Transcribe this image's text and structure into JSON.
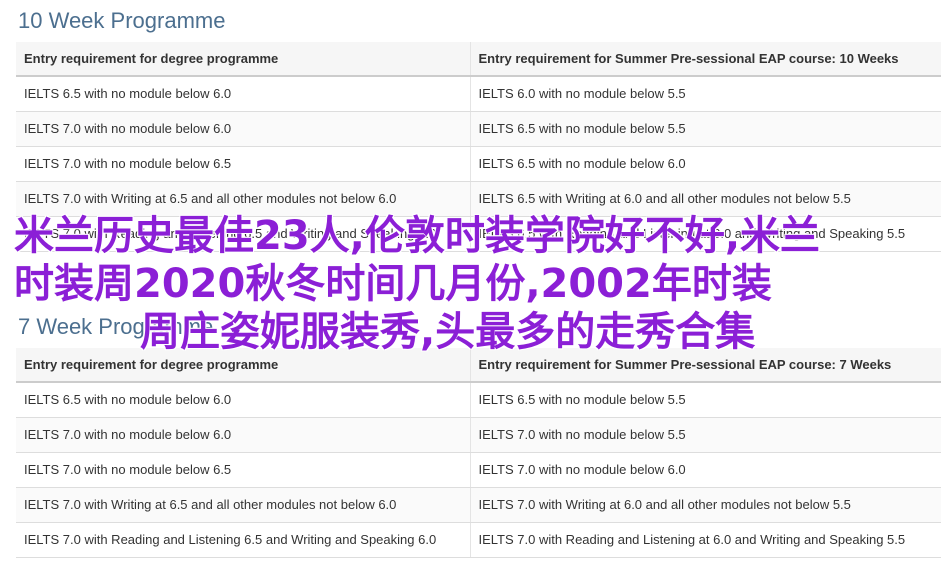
{
  "sections": [
    {
      "title": "10 Week Programme",
      "headers": [
        "Entry requirement for degree programme",
        "Entry requirement for Summer Pre-sessional EAP course: 10 Weeks"
      ],
      "rows": [
        [
          "IELTS 6.5 with no module below 6.0",
          "IELTS 6.0 with no module below 5.5"
        ],
        [
          "IELTS 7.0 with no module below 6.0",
          "IELTS 6.5 with no module below 5.5"
        ],
        [
          "IELTS 7.0 with no module below 6.5",
          "IELTS 6.5 with no module below 6.0"
        ],
        [
          "IELTS 7.0 with Writing at 6.5 and all other modules not below 6.0",
          "IELTS 6.5 with Writing at 6.0 and all other modules not below 5.5"
        ],
        [
          "IELTS 7.0 with Reading and Listening 6.5 and Writing and Speaking 6.0",
          "IELTS 6.5 with Reading and Listening at 6.0 and Writing and Speaking 5.5"
        ]
      ]
    },
    {
      "title": "7 Week Programme",
      "headers": [
        "Entry requirement for degree programme",
        "Entry requirement for Summer Pre-sessional EAP course: 7 Weeks"
      ],
      "rows": [
        [
          "IELTS 6.5 with no module below 6.0",
          "IELTS 6.5 with no module below 5.5"
        ],
        [
          "IELTS 7.0 with no module below 6.0",
          "IELTS 7.0 with no module below 5.5"
        ],
        [
          "IELTS 7.0 with no module below 6.5",
          "IELTS 7.0 with no module below 6.0"
        ],
        [
          "IELTS 7.0 with Writing at 6.5 and all other modules not below 6.0",
          "IELTS 7.0 with Writing at 6.0 and all other modules not below 5.5"
        ],
        [
          "IELTS 7.0 with Reading and Listening 6.5 and Writing and Speaking 6.0",
          "IELTS 7.0 with Reading and Listening at 6.0 and Writing and Speaking 5.5"
        ]
      ]
    }
  ],
  "overlay": {
    "line1": "米兰历史最佳23人,伦敦时装学院好不好,米兰",
    "line2": "时装周2020秋冬时间几月份,2002年时装",
    "line3": "周庄姿妮服装秀,头最多的走秀合集",
    "color": "#8b1fd6"
  }
}
